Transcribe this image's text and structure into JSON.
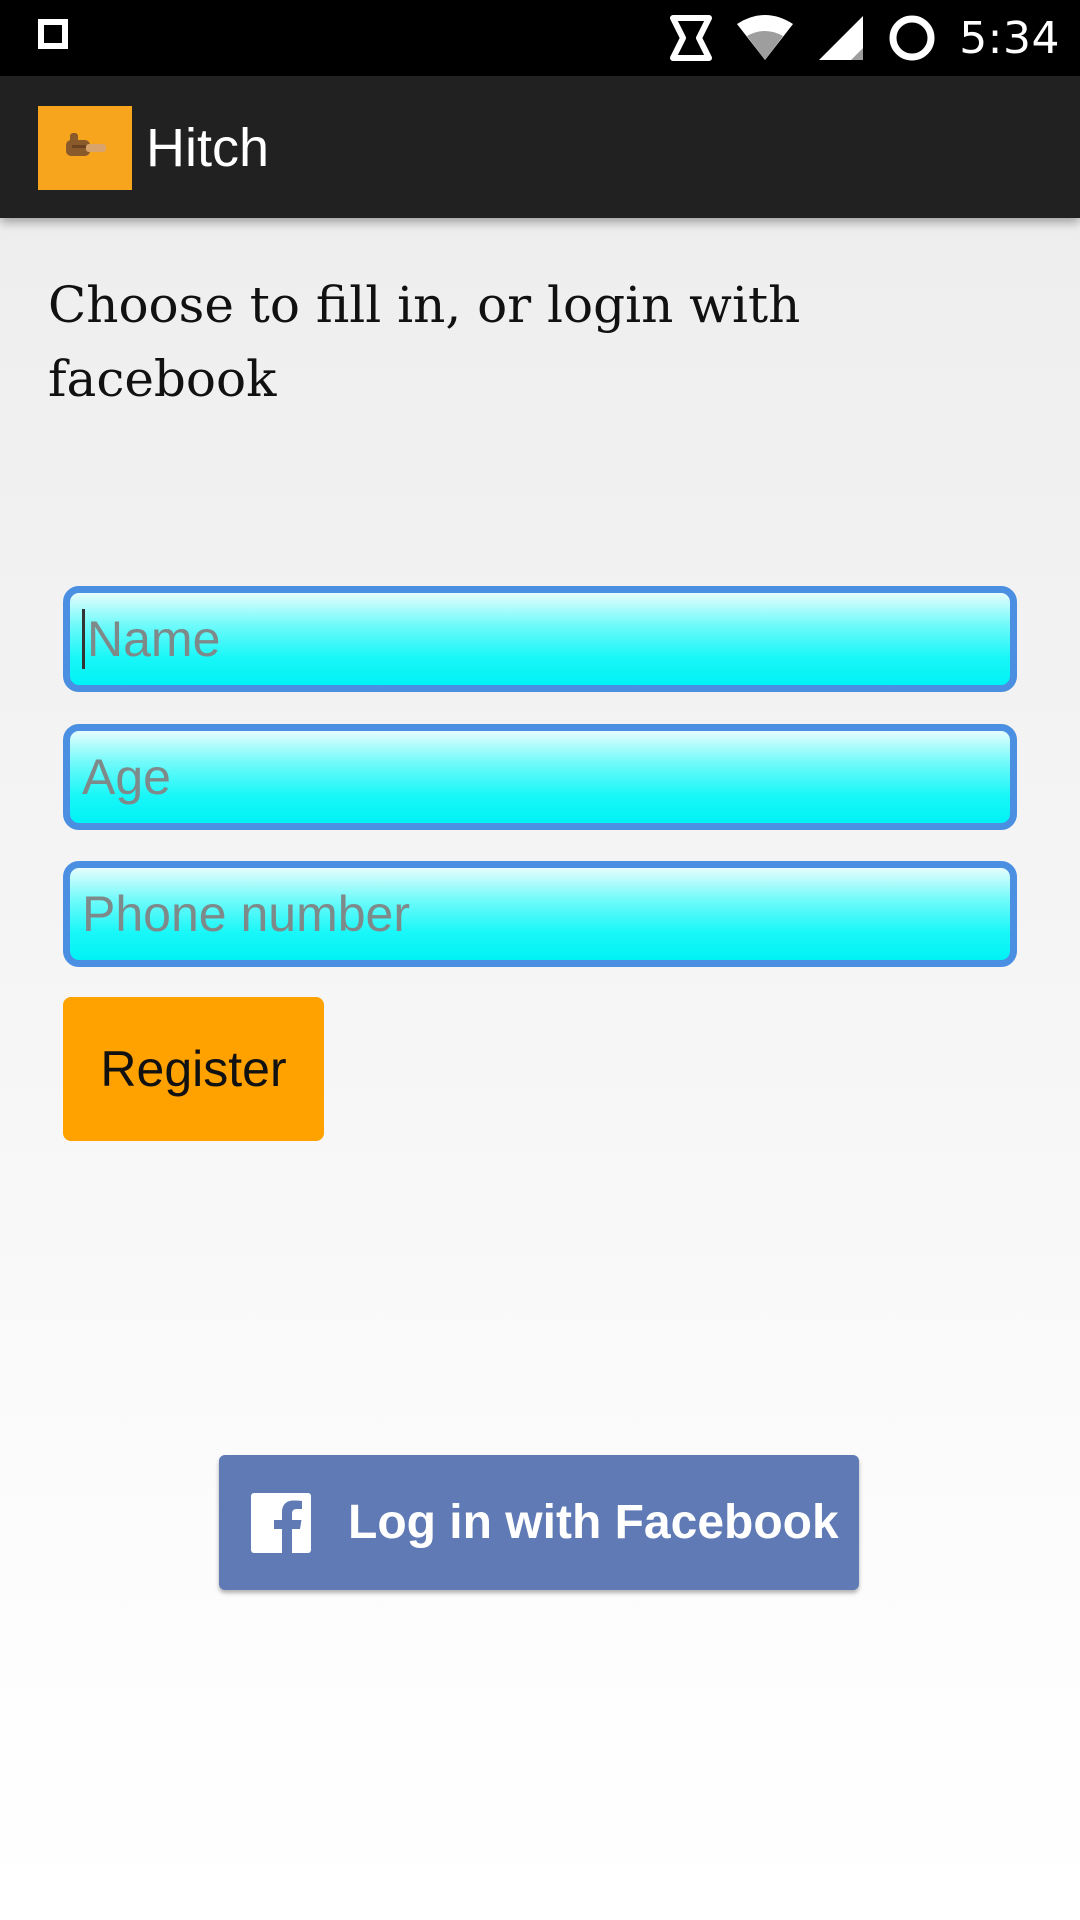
{
  "status_bar": {
    "time": "5:34",
    "icons": [
      "notification-square-icon",
      "data-sync-icon",
      "wifi-icon",
      "cell-signal-icon",
      "battery-ring-icon"
    ]
  },
  "app_bar": {
    "title": "Hitch",
    "logo_icon": "thumbs-up-hitchhike-icon",
    "background": "#212121",
    "logo_background": "#f7a51c"
  },
  "intro": {
    "text": "Choose to fill in, or login with facebook"
  },
  "form": {
    "name_placeholder": "Name",
    "age_placeholder": "Age",
    "phone_placeholder": "Phone number",
    "name_value": "",
    "age_value": "",
    "phone_value": "",
    "field_border_color": "#4a8fe2",
    "field_fill_color": "#00f2f5"
  },
  "register": {
    "label": "Register",
    "color": "#ffa200"
  },
  "facebook": {
    "label": "Log in with Facebook",
    "icon": "facebook-f-icon",
    "color": "#5f7ab5"
  }
}
